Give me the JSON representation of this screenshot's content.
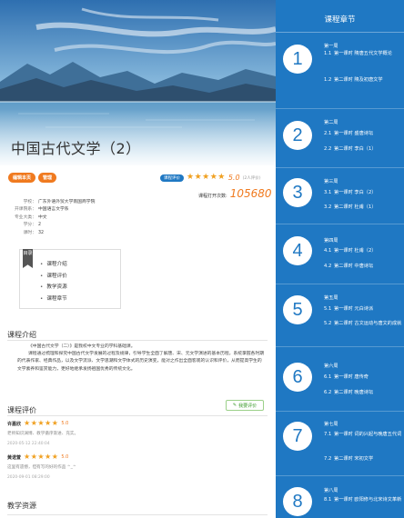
{
  "course": {
    "title": "中国古代文学（2）",
    "edit_button": "编辑本页",
    "manage_button": "管理",
    "rating_tag": "课程评价",
    "stars": "★★★★★",
    "score": "5.0",
    "score_count": "(2人评价)",
    "opens_label": "课程打开次数:",
    "opens_count": "105680"
  },
  "info": [
    {
      "key": "学校：",
      "value": "广东外语外贸大学南国商学院"
    },
    {
      "key": "开课院系：",
      "value": "中国语言文学系"
    },
    {
      "key": "专业大类：",
      "value": "中文"
    },
    {
      "key": "学分：",
      "value": "2"
    },
    {
      "key": "课时：",
      "value": "32"
    }
  ],
  "toc": {
    "tag": "目录",
    "items": [
      "课程介绍",
      "课程评价",
      "教学资源",
      "课程章节"
    ]
  },
  "intro": {
    "title": "课程介绍",
    "paragraph1": "《中国古代文学（二）》是我校中文专业的学科基础课。",
    "paragraph2": "课程通过梳理和探究中国古代文学发展的过程及规律，引导学生全面了解唐、宋、元文学演进的基本历程，系统掌握各时期的代表作家、经典作品，以及文学流派、文学思潮和文学体式的历史演变，能对之作出全面客观的认识和评价，从而提高学生的文学素养和鉴赏能力，更好地继承发扬祖国优秀的传统文化。"
  },
  "evaluation": {
    "title": "课程评价",
    "button": "我要评价",
    "reviews": [
      {
        "name": "许嘉欣",
        "stars": "★★★★★",
        "score": "5.0",
        "text": "老师知识渊博、教学循序渐进、充实。",
        "date": "2020-05-12 22:40:04"
      },
      {
        "name": "黄诺萱",
        "stars": "★★★★★",
        "score": "5.0",
        "text": "这里有遗憾，但有写的好的作品 ^_^",
        "date": "2020-09-01 08:29:00"
      }
    ]
  },
  "resources": {
    "title": "教学资源"
  },
  "sidebar": {
    "title": "课程章节",
    "weeks": [
      {
        "num": "1",
        "label": "第一周",
        "items": [
          {
            "n": "1.1",
            "t": "第一课时 隋唐五代文学概论"
          },
          {
            "n": "1.2",
            "t": "第二课时 隋及初唐文学"
          }
        ]
      },
      {
        "num": "2",
        "label": "第二周",
        "items": [
          {
            "n": "2.1",
            "t": "第一课时 盛唐诗坛"
          },
          {
            "n": "2.2",
            "t": "第二课时 李白（1）"
          }
        ]
      },
      {
        "num": "3",
        "label": "第三周",
        "items": [
          {
            "n": "3.1",
            "t": "第一课时 李白（2）"
          },
          {
            "n": "3.2",
            "t": "第二课时 杜甫（1）"
          }
        ]
      },
      {
        "num": "4",
        "label": "第四周",
        "items": [
          {
            "n": "4.1",
            "t": "第一课时 杜甫（2）"
          },
          {
            "n": "4.2",
            "t": "第二课时 中唐诗坛"
          }
        ]
      },
      {
        "num": "5",
        "label": "第五周",
        "items": [
          {
            "n": "5.1",
            "t": "第一课时 元白诗派"
          },
          {
            "n": "5.2",
            "t": "第二课时 古文运动与唐文的成就"
          }
        ]
      },
      {
        "num": "6",
        "label": "第六周",
        "items": [
          {
            "n": "6.1",
            "t": "第一课时 唐传奇"
          },
          {
            "n": "6.2",
            "t": "第二课时 晚唐诗坛"
          }
        ]
      },
      {
        "num": "7",
        "label": "第七周",
        "items": [
          {
            "n": "7.1",
            "t": "第一课时 词的兴起与晚唐五代词"
          },
          {
            "n": "7.2",
            "t": "第二课时 宋初文学"
          }
        ]
      },
      {
        "num": "8",
        "label": "第八周",
        "items": [
          {
            "n": "8.1",
            "t": "第一课时 欧阳修与北宋诗文革新"
          }
        ]
      }
    ]
  },
  "colors": {
    "sidebar": "#1f78c3",
    "accent": "#f07a1f",
    "star": "#f0a020"
  }
}
